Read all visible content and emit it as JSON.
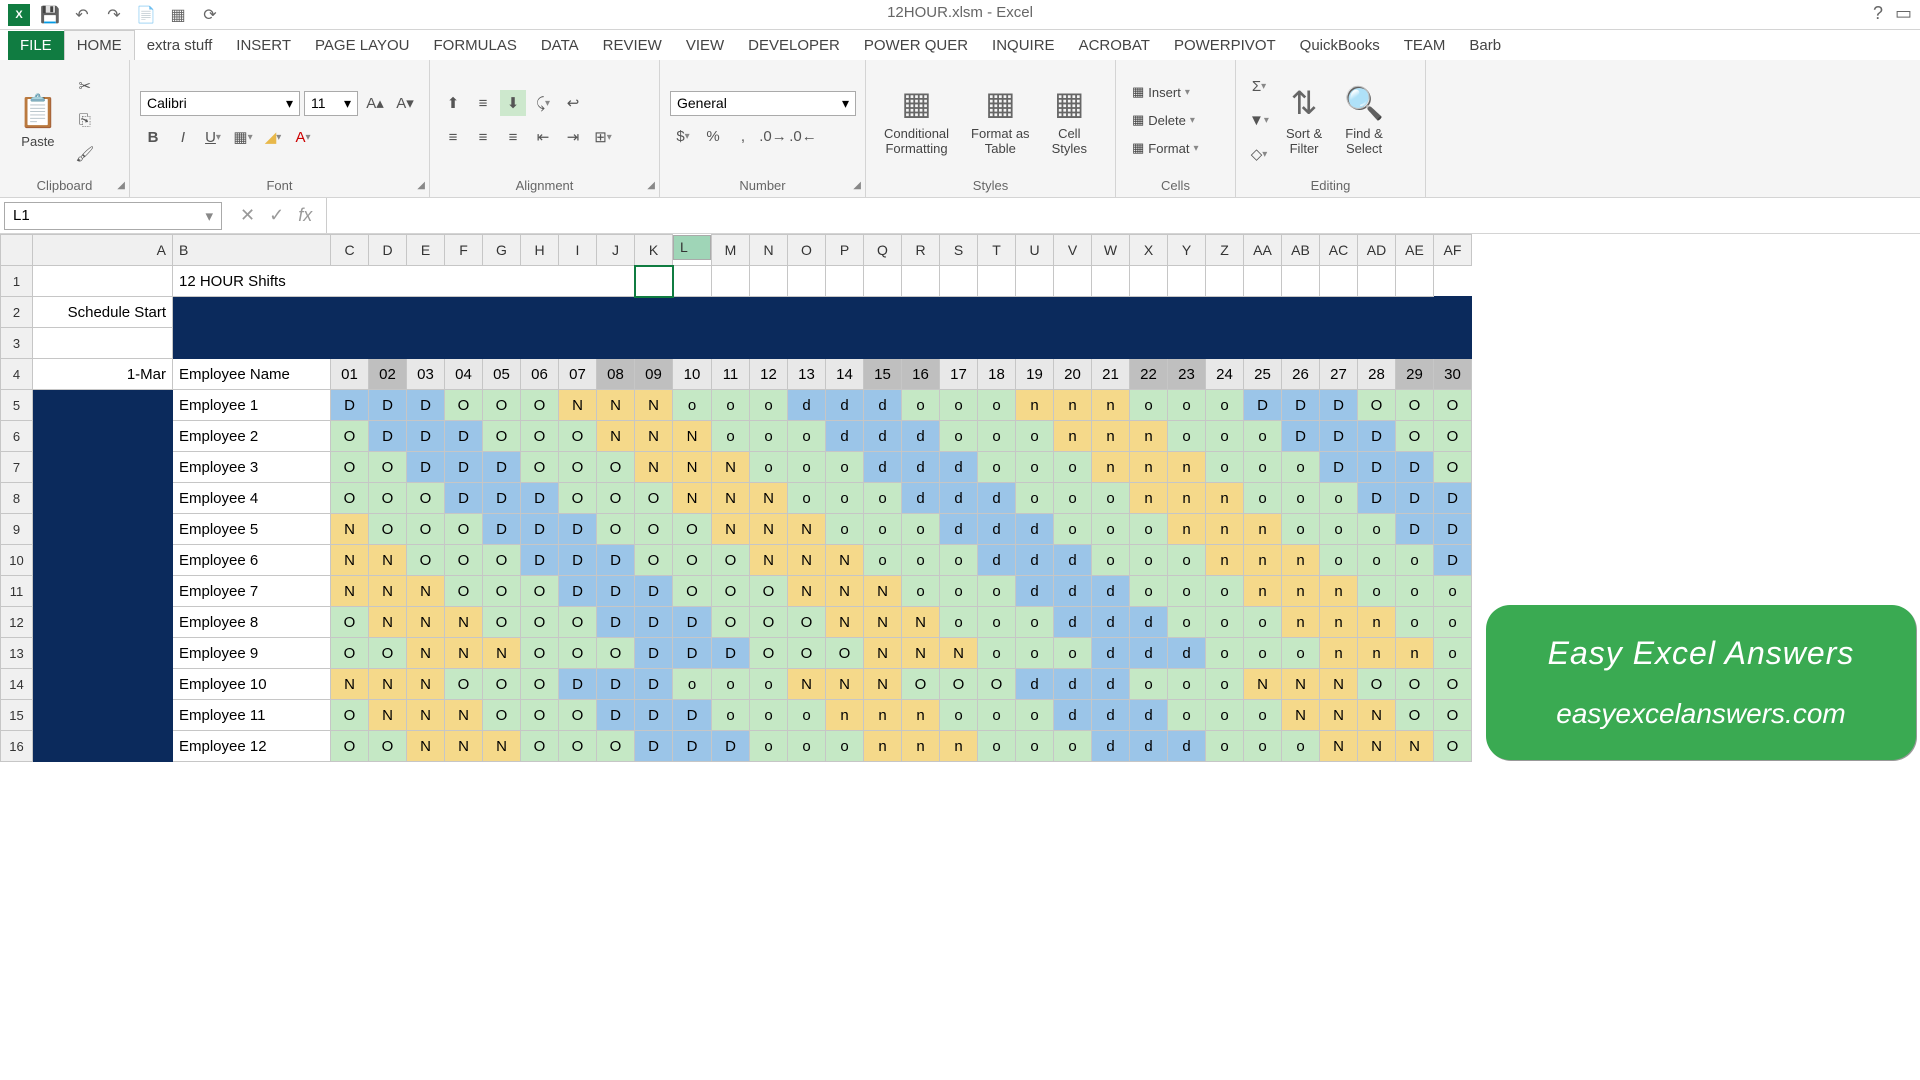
{
  "window": {
    "title": "12HOUR.xlsm - Excel"
  },
  "tabs": [
    "FILE",
    "HOME",
    "extra stuff",
    "INSERT",
    "PAGE LAYOU",
    "FORMULAS",
    "DATA",
    "REVIEW",
    "VIEW",
    "DEVELOPER",
    "POWER QUER",
    "INQUIRE",
    "ACROBAT",
    "POWERPIVOT",
    "QuickBooks",
    "TEAM",
    "Barb"
  ],
  "active_tab": "HOME",
  "clipboard": {
    "label": "Clipboard",
    "paste": "Paste"
  },
  "font": {
    "label": "Font",
    "name": "Calibri",
    "size": "11"
  },
  "align": {
    "label": "Alignment"
  },
  "number": {
    "label": "Number",
    "format": "General"
  },
  "styles": {
    "label": "Styles",
    "cond": "Conditional\nFormatting",
    "table": "Format as\nTable",
    "cell": "Cell\nStyles"
  },
  "cells": {
    "label": "Cells",
    "insert": "Insert",
    "delete": "Delete",
    "format": "Format"
  },
  "editing": {
    "label": "Editing",
    "sort": "Sort &\nFilter",
    "find": "Find &\nSelect"
  },
  "namebox": "L1",
  "cols": [
    "A",
    "B",
    "C",
    "D",
    "E",
    "F",
    "G",
    "H",
    "I",
    "J",
    "K",
    "L",
    "M",
    "N",
    "O",
    "P",
    "Q",
    "R",
    "S",
    "T",
    "U",
    "V",
    "W",
    "X",
    "Y",
    "Z",
    "AA",
    "AB",
    "AC",
    "AD",
    "AE",
    "AF"
  ],
  "title_cell": "12 HOUR  Shifts",
  "schedule_start": "Schedule Start",
  "date": "1-Mar",
  "emp_hdr": "Employee Name",
  "days": [
    "01",
    "02",
    "03",
    "04",
    "05",
    "06",
    "07",
    "08",
    "09",
    "10",
    "11",
    "12",
    "13",
    "14",
    "15",
    "16",
    "17",
    "18",
    "19",
    "20",
    "21",
    "22",
    "23",
    "24",
    "25",
    "26",
    "27",
    "28",
    "29",
    "30"
  ],
  "day_highlight": [
    1,
    7,
    8,
    14,
    15,
    21,
    22,
    28,
    29
  ],
  "employees": [
    "Employee 1",
    "Employee 2",
    "Employee 3",
    "Employee 4",
    "Employee 5",
    "Employee 6",
    "Employee 7",
    "Employee 8",
    "Employee 9",
    "Employee 10",
    "Employee 11",
    "Employee 12"
  ],
  "shifts": [
    [
      "D",
      "D",
      "D",
      "O",
      "O",
      "O",
      "N",
      "N",
      "N",
      "o",
      "o",
      "o",
      "d",
      "d",
      "d",
      "o",
      "o",
      "o",
      "n",
      "n",
      "n",
      "o",
      "o",
      "o",
      "D",
      "D",
      "D",
      "O",
      "O",
      "O"
    ],
    [
      "O",
      "D",
      "D",
      "D",
      "O",
      "O",
      "O",
      "N",
      "N",
      "N",
      "o",
      "o",
      "o",
      "d",
      "d",
      "d",
      "o",
      "o",
      "o",
      "n",
      "n",
      "n",
      "o",
      "o",
      "o",
      "D",
      "D",
      "D",
      "O",
      "O"
    ],
    [
      "O",
      "O",
      "D",
      "D",
      "D",
      "O",
      "O",
      "O",
      "N",
      "N",
      "N",
      "o",
      "o",
      "o",
      "d",
      "d",
      "d",
      "o",
      "o",
      "o",
      "n",
      "n",
      "n",
      "o",
      "o",
      "o",
      "D",
      "D",
      "D",
      "O"
    ],
    [
      "O",
      "O",
      "O",
      "D",
      "D",
      "D",
      "O",
      "O",
      "O",
      "N",
      "N",
      "N",
      "o",
      "o",
      "o",
      "d",
      "d",
      "d",
      "o",
      "o",
      "o",
      "n",
      "n",
      "n",
      "o",
      "o",
      "o",
      "D",
      "D",
      "D"
    ],
    [
      "N",
      "O",
      "O",
      "O",
      "D",
      "D",
      "D",
      "O",
      "O",
      "O",
      "N",
      "N",
      "N",
      "o",
      "o",
      "o",
      "d",
      "d",
      "d",
      "o",
      "o",
      "o",
      "n",
      "n",
      "n",
      "o",
      "o",
      "o",
      "D",
      "D"
    ],
    [
      "N",
      "N",
      "O",
      "O",
      "O",
      "D",
      "D",
      "D",
      "O",
      "O",
      "O",
      "N",
      "N",
      "N",
      "o",
      "o",
      "o",
      "d",
      "d",
      "d",
      "o",
      "o",
      "o",
      "n",
      "n",
      "n",
      "o",
      "o",
      "o",
      "D"
    ],
    [
      "N",
      "N",
      "N",
      "O",
      "O",
      "O",
      "D",
      "D",
      "D",
      "O",
      "O",
      "O",
      "N",
      "N",
      "N",
      "o",
      "o",
      "o",
      "d",
      "d",
      "d",
      "o",
      "o",
      "o",
      "n",
      "n",
      "n",
      "o",
      "o",
      "o"
    ],
    [
      "O",
      "N",
      "N",
      "N",
      "O",
      "O",
      "O",
      "D",
      "D",
      "D",
      "O",
      "O",
      "O",
      "N",
      "N",
      "N",
      "o",
      "o",
      "o",
      "d",
      "d",
      "d",
      "o",
      "o",
      "o",
      "n",
      "n",
      "n",
      "o",
      "o"
    ],
    [
      "O",
      "O",
      "N",
      "N",
      "N",
      "O",
      "O",
      "O",
      "D",
      "D",
      "D",
      "O",
      "O",
      "O",
      "N",
      "N",
      "N",
      "o",
      "o",
      "o",
      "d",
      "d",
      "d",
      "o",
      "o",
      "o",
      "n",
      "n",
      "n",
      "o"
    ],
    [
      "N",
      "N",
      "N",
      "O",
      "O",
      "O",
      "D",
      "D",
      "D",
      "o",
      "o",
      "o",
      "N",
      "N",
      "N",
      "O",
      "O",
      "O",
      "d",
      "d",
      "d",
      "o",
      "o",
      "o",
      "N",
      "N",
      "N",
      "O",
      "O",
      "O"
    ],
    [
      "O",
      "N",
      "N",
      "N",
      "O",
      "O",
      "O",
      "D",
      "D",
      "D",
      "o",
      "o",
      "o",
      "n",
      "n",
      "n",
      "o",
      "o",
      "o",
      "d",
      "d",
      "d",
      "o",
      "o",
      "o",
      "N",
      "N",
      "N",
      "O",
      "O"
    ],
    [
      "O",
      "O",
      "N",
      "N",
      "N",
      "O",
      "O",
      "O",
      "D",
      "D",
      "D",
      "o",
      "o",
      "o",
      "n",
      "n",
      "n",
      "o",
      "o",
      "o",
      "d",
      "d",
      "d",
      "o",
      "o",
      "o",
      "N",
      "N",
      "N",
      "O"
    ]
  ],
  "overlay": {
    "t1": "Easy  Excel  Answers",
    "t2": "easyexcelanswers.com"
  }
}
